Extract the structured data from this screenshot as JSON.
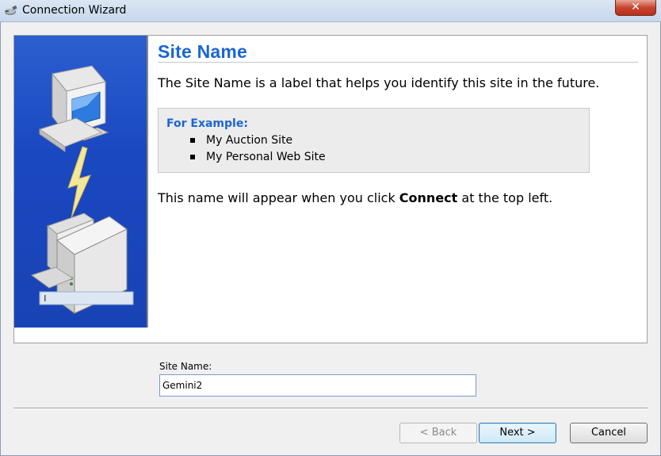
{
  "window": {
    "title": "Connection Wizard",
    "close_label": "✕"
  },
  "page": {
    "heading": "Site Name",
    "intro": "The Site Name is a label that helps you identify this site in the future.",
    "example_title": "For Example:",
    "examples": [
      "My Auction Site",
      "My Personal Web Site"
    ],
    "note_prefix": "This name will appear when you click ",
    "note_bold": "Connect",
    "note_suffix": " at the top left."
  },
  "form": {
    "site_name_label": "Site Name:",
    "site_name_value": "Gemini2"
  },
  "buttons": {
    "back": "< Back",
    "next": "Next >",
    "cancel": "Cancel"
  },
  "icons": {
    "app": "connection-plug-icon",
    "illustration": "computer-connection-illustration"
  },
  "colors": {
    "heading": "#1a66d2",
    "sidebar": "#1a48c0"
  }
}
